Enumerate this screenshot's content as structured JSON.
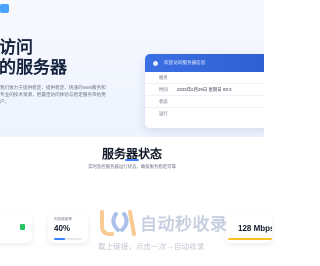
{
  "hero": {
    "title_line1": "访问",
    "title_line2": "的服务器",
    "description": "我们致力于提供稳定、提供稳定、快速的Web服务和专业的技术资源，把最佳访问体验与稳定服务带给用户。"
  },
  "panel": {
    "header": "欢迎访问服务器信息",
    "rows": [
      {
        "key": "服务",
        "value": ""
      },
      {
        "key": "时间",
        "value": "2025年6月29日 星期日 08:3"
      },
      {
        "key": "状态",
        "value": ""
      },
      {
        "key": "运行",
        "value": ""
      }
    ]
  },
  "status_section": {
    "title": "服务器状态",
    "subtitle": "实时监控服务器运行状态，确保服务稳定可靠",
    "cards": [
      {
        "label": "",
        "value": ""
      },
      {
        "label": "内存使用率",
        "value": "40%",
        "fraction": 0.4
      },
      {
        "label": "",
        "value": "128 Mbps"
      }
    ]
  },
  "watermark": {
    "title": "自动秒收录",
    "subtitle": "载上链接，点击一次→自动收录"
  },
  "colors": {
    "accent": "#3b82f6",
    "panel_header": "#3b6fe4",
    "title": "#16233e"
  }
}
